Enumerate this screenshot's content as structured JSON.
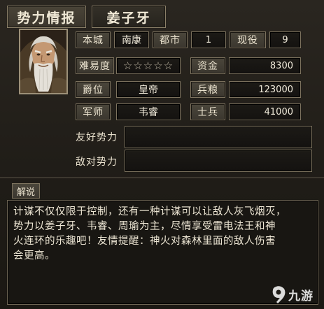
{
  "header": {
    "title": "势力情报",
    "ruler_name": "姜子牙"
  },
  "portrait": {
    "icon": "old-sage-portrait"
  },
  "stats": {
    "home_city_label": "本城",
    "home_city_value": "南康",
    "cities_label": "都市",
    "cities_value": "1",
    "active_label": "现役",
    "active_value": "9",
    "difficulty_label": "难易度",
    "difficulty_value": "☆☆☆☆☆",
    "funds_label": "资金",
    "funds_value": "8300",
    "rank_label": "爵位",
    "rank_value": "皇帝",
    "food_label": "兵粮",
    "food_value": "123000",
    "advisor_label": "军师",
    "advisor_value": "韦睿",
    "soldiers_label": "士兵",
    "soldiers_value": "41000",
    "allies_label": "友好势力",
    "allies_value": "",
    "enemies_label": "敌对势力",
    "enemies_value": ""
  },
  "explanation": {
    "tab_label": "解说",
    "lines": [
      "计谋不仅仅限于控制，还有一种计谋可以让敌人灰飞烟灭，",
      "势力以姜子牙、韦睿、周瑜为主，尽情享受雷电法王和神",
      "火连环的乐趣吧！友情提醒：神火对森林里面的敌人伤害",
      "会更高。"
    ]
  },
  "watermark": {
    "text": "九游",
    "icon": "9game-logo-icon"
  },
  "colors": {
    "background": "#1d1a14",
    "label_bg": "#4b463b",
    "value_bg": "#141210",
    "border": "#7c725e",
    "text": "#ece5d3"
  }
}
